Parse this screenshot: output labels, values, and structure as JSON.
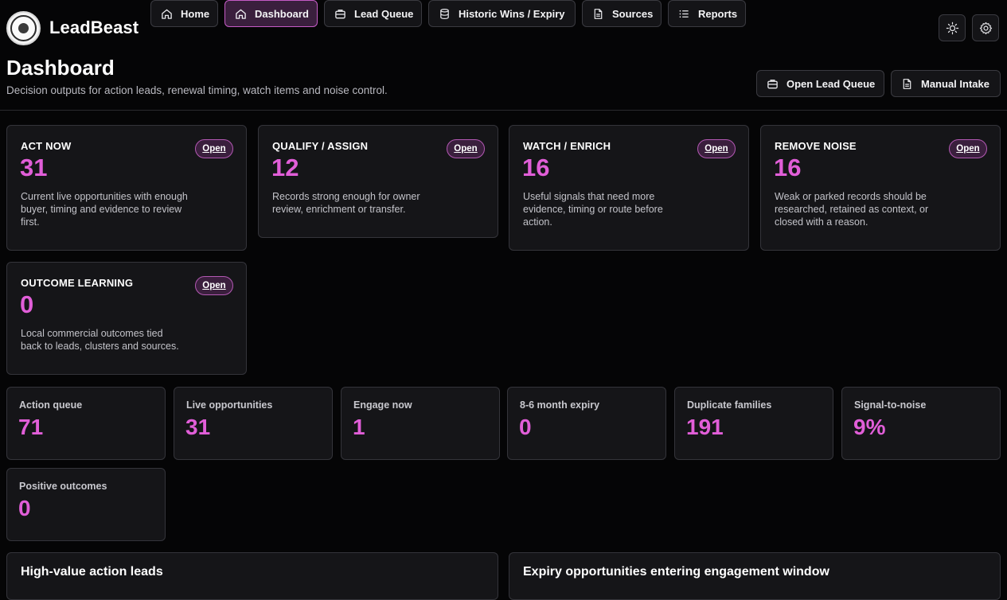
{
  "app": {
    "brand": "LeadBeast"
  },
  "nav": [
    {
      "label": "Home",
      "icon": "home-icon"
    },
    {
      "label": "Dashboard",
      "icon": "home-icon",
      "active": true
    },
    {
      "label": "Lead Queue",
      "icon": "briefcase-icon"
    },
    {
      "label": "Historic Wins / Expiry",
      "icon": "database-icon"
    },
    {
      "label": "Sources",
      "icon": "document-icon"
    },
    {
      "label": "Reports",
      "icon": "list-icon"
    }
  ],
  "toolbar": {
    "theme_icon": "sun-icon",
    "settings_icon": "gear-icon"
  },
  "header": {
    "title": "Dashboard",
    "subtitle": "Decision outputs for action leads, renewal timing, watch items and noise control.",
    "open_queue_label": "Open Lead Queue",
    "manual_intake_label": "Manual Intake"
  },
  "decisions": [
    {
      "title": "ACT NOW",
      "value": "31",
      "open": "Open",
      "desc": "Current live opportunities with enough buyer, timing and evidence to review first."
    },
    {
      "title": "QUALIFY / ASSIGN",
      "value": "12",
      "open": "Open",
      "desc": "Records strong enough for owner review, enrichment or transfer."
    },
    {
      "title": "WATCH / ENRICH",
      "value": "16",
      "open": "Open",
      "desc": "Useful signals that need more evidence, timing or route before action."
    },
    {
      "title": "REMOVE NOISE",
      "value": "16",
      "open": "Open",
      "desc": "Weak or parked records should be researched, retained as context, or closed with a reason."
    },
    {
      "title": "OUTCOME LEARNING",
      "value": "0",
      "open": "Open",
      "desc": "Local commercial outcomes tied back to leads, clusters and sources."
    }
  ],
  "kpis": [
    {
      "label": "Action queue",
      "value": "71"
    },
    {
      "label": "Live opportunities",
      "value": "31"
    },
    {
      "label": "Engage now",
      "value": "1"
    },
    {
      "label": "8-6 month expiry",
      "value": "0"
    },
    {
      "label": "Duplicate families",
      "value": "191"
    },
    {
      "label": "Signal-to-noise",
      "value": "9%"
    },
    {
      "label": "Positive outcomes",
      "value": "0"
    }
  ],
  "panels": {
    "left_title": "High-value action leads",
    "right_title": "Expiry opportunities entering engagement window"
  },
  "colors": {
    "accent": "#e15ed8",
    "active_bg": "#3a1f3d",
    "active_border": "#c55bc6",
    "background": "#050506",
    "card": "#151518"
  }
}
